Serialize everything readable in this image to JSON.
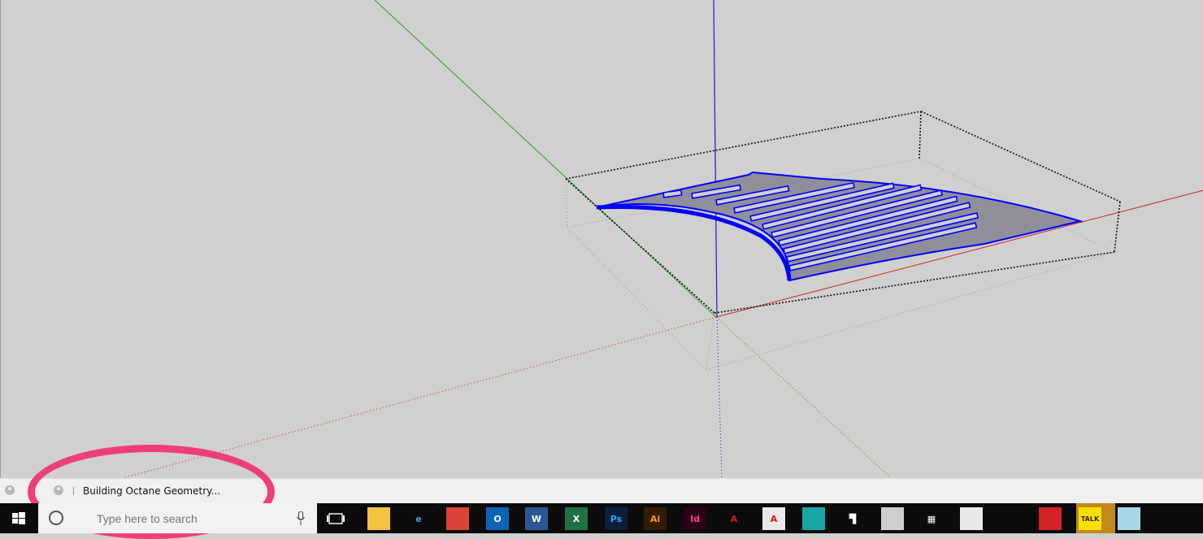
{
  "statusbar": {
    "message": "Building Octane Geometry..."
  },
  "search": {
    "placeholder": "Type here to search"
  },
  "taskbar": {
    "apps": [
      {
        "name": "file-explorer-app-icon",
        "glyph": "",
        "bg": "#f5c242",
        "fg": "#1f6fbf"
      },
      {
        "name": "internet-explorer-app-icon",
        "glyph": "e",
        "bg": "transparent",
        "fg": "#37a3f0"
      },
      {
        "name": "chrome-app-icon",
        "glyph": "",
        "bg": "#db4437",
        "fg": "#fff"
      },
      {
        "name": "outlook-app-icon",
        "glyph": "O",
        "bg": "#0a64b4",
        "fg": "#fff"
      },
      {
        "name": "word-app-icon",
        "glyph": "W",
        "bg": "#2b5797",
        "fg": "#fff"
      },
      {
        "name": "excel-app-icon",
        "glyph": "X",
        "bg": "#1e7145",
        "fg": "#fff"
      },
      {
        "name": "photoshop-app-icon",
        "glyph": "Ps",
        "bg": "#0b1f3d",
        "fg": "#31a8ff"
      },
      {
        "name": "illustrator-app-icon",
        "glyph": "Ai",
        "bg": "#331c00",
        "fg": "#ff9a00"
      },
      {
        "name": "indesign-app-icon",
        "glyph": "Id",
        "bg": "#2d0018",
        "fg": "#ff3f94"
      },
      {
        "name": "autocad-app-icon",
        "glyph": "A",
        "bg": "transparent",
        "fg": "#e0161b"
      },
      {
        "name": "autocad-lt-app-icon",
        "glyph": "A",
        "bg": "#e8e8e8",
        "fg": "#d11"
      },
      {
        "name": "3ds-max-app-icon",
        "glyph": "",
        "bg": "#1aa5a5",
        "fg": "#fff"
      },
      {
        "name": "app-icon-14",
        "glyph": "▜",
        "bg": "transparent",
        "fg": "#fff"
      },
      {
        "name": "app-icon-15",
        "glyph": "",
        "bg": "#cfcfcf",
        "fg": "#222"
      },
      {
        "name": "calculator-app-icon",
        "glyph": "▦",
        "bg": "transparent",
        "fg": "#fff"
      },
      {
        "name": "paint-app-icon",
        "glyph": "",
        "bg": "#e9e9e9",
        "fg": "#c33"
      },
      {
        "name": "app-icon-18",
        "glyph": "",
        "bg": "transparent",
        "fg": "#fff"
      },
      {
        "name": "sketchup-app-icon",
        "glyph": "",
        "bg": "#d2232a",
        "fg": "#fff"
      },
      {
        "name": "kakaotalk-app-icon",
        "glyph": "TALK",
        "bg": "#f9e000",
        "fg": "#3c1e1e"
      },
      {
        "name": "app-icon-21",
        "glyph": "",
        "bg": "#a8d8e8",
        "fg": "#1b6"
      },
      {
        "name": "acrobat-app-icon",
        "glyph": "",
        "bg": "transparent",
        "fg": "#e0161b"
      }
    ]
  },
  "colors": {
    "viewport_bg": "#d0d0ce",
    "axis_red": "#cc2020",
    "axis_green": "#2aa02a",
    "axis_blue": "#1a1adc",
    "selection_blue": "#0000ff",
    "highlight_pink": "#ef3f78"
  }
}
